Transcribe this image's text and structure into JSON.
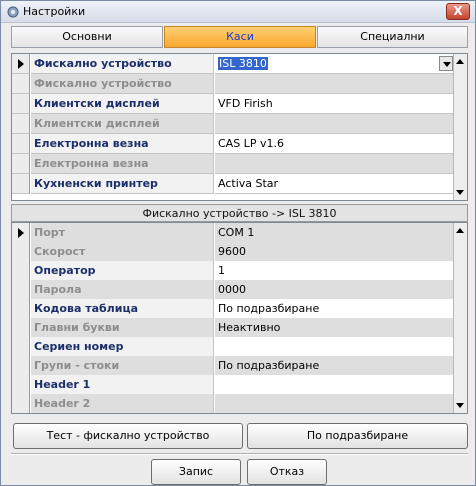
{
  "window": {
    "title": "Настройки",
    "close_label": "X",
    "title_icon": "settings-gear-icon"
  },
  "tabs": [
    {
      "label": "Основни",
      "active": false
    },
    {
      "label": "Каси",
      "active": true
    },
    {
      "label": "Специални",
      "active": false
    }
  ],
  "devices": [
    {
      "name": "Фискално устройство",
      "value": "ISL 3810",
      "selected": true
    },
    {
      "name": "Фискално устройство",
      "value": "",
      "readonly": true
    },
    {
      "name": "Клиентски дисплей",
      "value": "VFD Firish"
    },
    {
      "name": "Клиентски дисплей",
      "value": "",
      "readonly": true
    },
    {
      "name": "Електронна везна",
      "value": "CAS LP v1.6"
    },
    {
      "name": "Електронна везна",
      "value": "",
      "readonly": true
    },
    {
      "name": "Кухненски принтер",
      "value": "Activa Star"
    }
  ],
  "section_title": "Фискално устройство -> ISL 3810",
  "properties": [
    {
      "name": "Порт",
      "value": "COM 1",
      "readonly": true,
      "selected": true
    },
    {
      "name": "Скорост",
      "value": "9600",
      "readonly": true
    },
    {
      "name": "Оператор",
      "value": "1"
    },
    {
      "name": "Парола",
      "value": "0000",
      "readonly": true
    },
    {
      "name": "Кодова таблица",
      "value": "По подразбиране"
    },
    {
      "name": "Главни букви",
      "value": "Неактивно",
      "readonly": true
    },
    {
      "name": "Сериен номер",
      "value": ""
    },
    {
      "name": "Групи - стоки",
      "value": "По подразбиране",
      "readonly": true
    },
    {
      "name": "Header 1",
      "value": ""
    },
    {
      "name": "Header 2",
      "value": "",
      "readonly": true
    }
  ],
  "actions": {
    "test_label": "Тест - фискално устройство",
    "default_label": "По подразбиране",
    "save_label": "Запис",
    "cancel_label": "Отказ"
  },
  "colors": {
    "active_tab": "#f8a830",
    "active_tab_text": "#1a3bd0",
    "selection": "#3366cc",
    "close_button": "#c4432c"
  }
}
